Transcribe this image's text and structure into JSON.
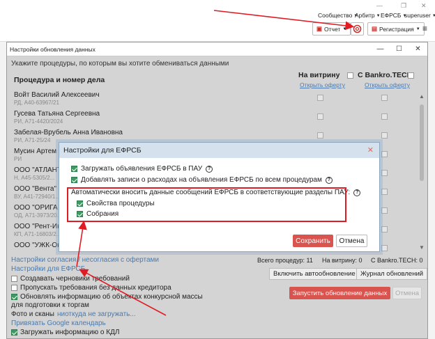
{
  "app": {
    "window_controls": [
      "—",
      "❐",
      "✕"
    ],
    "menu": [
      "Сообщество",
      "Арбитр",
      "ЕФРСБ",
      "superuser"
    ],
    "report_label": "Отчет",
    "registration_label": "Регистрация"
  },
  "main_window": {
    "title": "Настройки обновления данных",
    "hint": "Укажите процедуры, по которым вы хотите обмениваться данными",
    "col_procedure": "Процедура и номер дела",
    "col_showcase": "На витрину",
    "col_bankro": "С Bankro.TECH",
    "offer_link": "Открыть оферту",
    "rows": [
      {
        "name": "Войт Василий Алексеевич",
        "sub": "РД, А40-63967/21"
      },
      {
        "name": "Гусева Татьяна Сергеевна",
        "sub": "РИ, А71-4420/2024"
      },
      {
        "name": "Забелая-Врубель Анна Ивановна",
        "sub": "РИ, А71-25/24"
      },
      {
        "name": "Мусин Артем",
        "sub": "РИ"
      },
      {
        "name": "ООО \"АТЛАНТ",
        "sub": "Н, А45-5305/2..."
      },
      {
        "name": "ООО \"Вента\"",
        "sub": "ВУ, А41-72940/1..."
      },
      {
        "name": "ООО \"ОРИГА",
        "sub": "ОД, А71-3973/20..."
      },
      {
        "name": "ООО \"Рент-Ин",
        "sub": "КП, А71-16803/2..."
      },
      {
        "name": "ООО \"УЖК-Ок",
        "sub": ""
      }
    ],
    "link_disagreement": "Настройки согласия / несогласия с офертами",
    "link_efrsb": "Настройки для ЕФРСБ",
    "stats": {
      "total": "Всего процедур: 11",
      "showcase": "На витрину: 0",
      "bankro": "С Bankro.TECH: 0"
    },
    "btn_autoupdate": "Включить автообновление",
    "btn_log": "Журнал обновлений",
    "btn_run": "Запустить обновление данных",
    "btn_cancel": "Отмена",
    "options": [
      {
        "label": "Создавать черновики требований",
        "checked": false
      },
      {
        "label": "Пропускать требования без данных кредитора",
        "checked": false
      },
      {
        "label": "Обновлять информацию об объектах конкурсной массы",
        "checked": true
      },
      {
        "label": "для подготовки к торгам",
        "checked": null
      }
    ],
    "photo_text": "Фото и сканы",
    "photo_link": "ниоткуда не загружать...",
    "google_link": "Привязать Google календарь",
    "kdl_label": "Загружать информацию о КДЛ"
  },
  "efrsb_dialog": {
    "title": "Настройки для ЕФРСБ",
    "close": "✕",
    "load_ads": "Загружать объявления ЕФРСБ в ПАУ",
    "add_expense": "Добавлять записи о расходах на объявления ЕФРСБ по всем процедурам",
    "auto_enter": "Автоматически вносить данные сообщений ЕФРСБ в соответствующие разделы ПАУ:",
    "props": "Свойства процедуры",
    "meetings": "Собрания",
    "save": "Сохранить",
    "cancel": "Отмена"
  },
  "colors": {
    "accent_red": "#d9534f",
    "link_blue": "#4a7aad",
    "check_green": "#3e9a63",
    "annotation_red": "#e01b24"
  }
}
